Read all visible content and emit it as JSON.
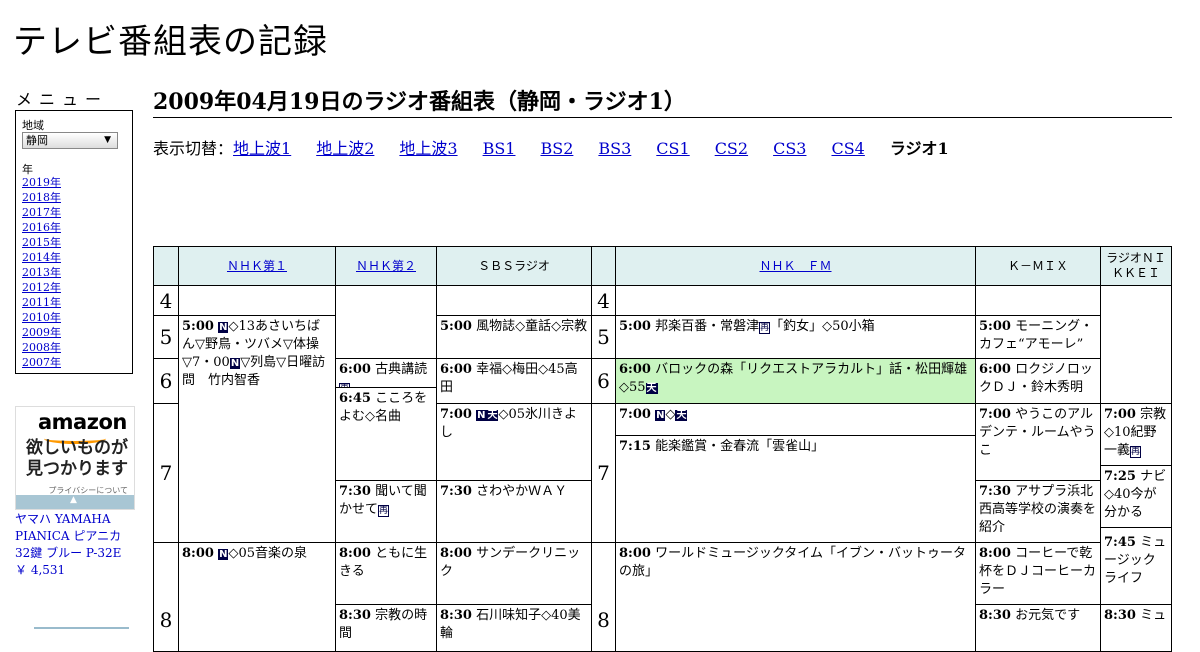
{
  "site": {
    "title": "テレビ番組表の記録"
  },
  "menu": {
    "heading": "メニュー",
    "region_label": "地域",
    "region_value": "静岡",
    "year_label": "年",
    "years": [
      "2019年",
      "2018年",
      "2017年",
      "2016年",
      "2015年",
      "2014年",
      "2013年",
      "2012年",
      "2011年",
      "2010年",
      "2009年",
      "2008年",
      "2007年"
    ]
  },
  "ad": {
    "logo": "amazon",
    "text": "欲しいものが見つかります",
    "privacy": "プライバシーについて",
    "arrow": "▲"
  },
  "product": {
    "name": "ヤマハ YAMAHA PIANICA ピアニカ 32鍵 ブルー P-32E",
    "price": "￥ 4,531"
  },
  "page": {
    "title": "2009年04月19日のラジオ番組表（静岡・ラジオ1）"
  },
  "switcher": {
    "label": "表示切替：",
    "links": [
      "地上波1",
      "地上波2",
      "地上波3",
      "BS1",
      "BS2",
      "BS3",
      "CS1",
      "CS2",
      "CS3",
      "CS4"
    ],
    "current": "ラジオ1"
  },
  "schedule": {
    "stations": [
      "ＮＨＫ第１",
      "ＮＨＫ第２",
      "ＳＢＳラジオ",
      "ＮＨＫ　ＦＭ",
      "Ｋ－ＭＩＸ",
      "ラジオＮＩＫＫＥＩ"
    ],
    "hours": [
      "4",
      "5",
      "6",
      "7",
      "8"
    ],
    "badges": {
      "news": "N",
      "weather": "天",
      "rebroadcast": "再"
    },
    "programs": {
      "nhk1_0500_time": "5:00",
      "nhk1_0500_title": "◇13あさいちばん▽野鳥・ツバメ▽体操▽7・00",
      "nhk1_0500_tail": "▽列島▽日曜訪問　竹内智香",
      "nhk1_0800_time": "8:00",
      "nhk1_0800_title": "◇05音楽の泉",
      "nhk2_0600_time": "6:00",
      "nhk2_0600_title": "古典講読",
      "nhk2_0645_time": "6:45",
      "nhk2_0645_title": "こころをよむ◇名曲",
      "nhk2_0730_time": "7:30",
      "nhk2_0730_title": "聞いて聞かせて",
      "nhk2_0800_time": "8:00",
      "nhk2_0800_title": "ともに生きる",
      "nhk2_0830_time": "8:30",
      "nhk2_0830_title": "宗教の時間",
      "sbs_0500_time": "5:00",
      "sbs_0500_title": "風物誌◇童話◇宗教",
      "sbs_0600_time": "6:00",
      "sbs_0600_title": "幸福◇梅田◇45高田",
      "sbs_0700_time": "7:00",
      "sbs_0700_title": "◇05氷川きよし",
      "sbs_0730_time": "7:30",
      "sbs_0730_title": "さわやかＷＡＹ",
      "sbs_0800_time": "8:00",
      "sbs_0800_title": "サンデークリニック",
      "sbs_0830_time": "8:30",
      "sbs_0830_title": "石川味知子◇40美輪",
      "fm_0500_time": "5:00",
      "fm_0500_title": "邦楽百番・常磐津",
      "fm_0500_tail": "「釣女」◇50小箱",
      "fm_0600_time": "6:00",
      "fm_0600_title": "バロックの森「リクエストアラカルト」話・松田輝雄◇55",
      "fm_0700_time": "7:00",
      "fm_0700_title": "◇",
      "fm_0715_time": "7:15",
      "fm_0715_title": "能楽鑑賞・金春流「雲雀山」",
      "fm_0800_time": "8:00",
      "fm_0800_title": "ワールドミュージックタイム「イブン・バットゥータの旅」",
      "kmix_0500_time": "5:00",
      "kmix_0500_title": "モーニング・カフェ“アモーレ”",
      "kmix_0600_time": "6:00",
      "kmix_0600_title": "ロクジノロックＤＪ・鈴木秀明",
      "kmix_0700_time": "7:00",
      "kmix_0700_title": "やうこのアルデンテ・ルームやうこ",
      "kmix_0730_time": "7:30",
      "kmix_0730_title": "アサプラ浜北西高等学校の演奏を紹介",
      "kmix_0800_time": "8:00",
      "kmix_0800_title": "コーヒーで乾杯をＤＪコーヒーカラー",
      "kmix_0830_time": "8:30",
      "kmix_0830_title": "お元気です",
      "nikkei_0700_time": "7:00",
      "nikkei_0700_title": "宗教◇10紀野一義",
      "nikkei_0725_time": "7:25",
      "nikkei_0725_title": "ナビ◇40今が分かる",
      "nikkei_0745_time": "7:45",
      "nikkei_0745_title": "ミュージックライフ",
      "nikkei_0830_time": "8:30",
      "nikkei_0830_title": "ミュ"
    }
  },
  "colors": {
    "header_bg": "#dff0f0",
    "highlight_bg": "#c8f5c0",
    "link": "#0000cc"
  }
}
